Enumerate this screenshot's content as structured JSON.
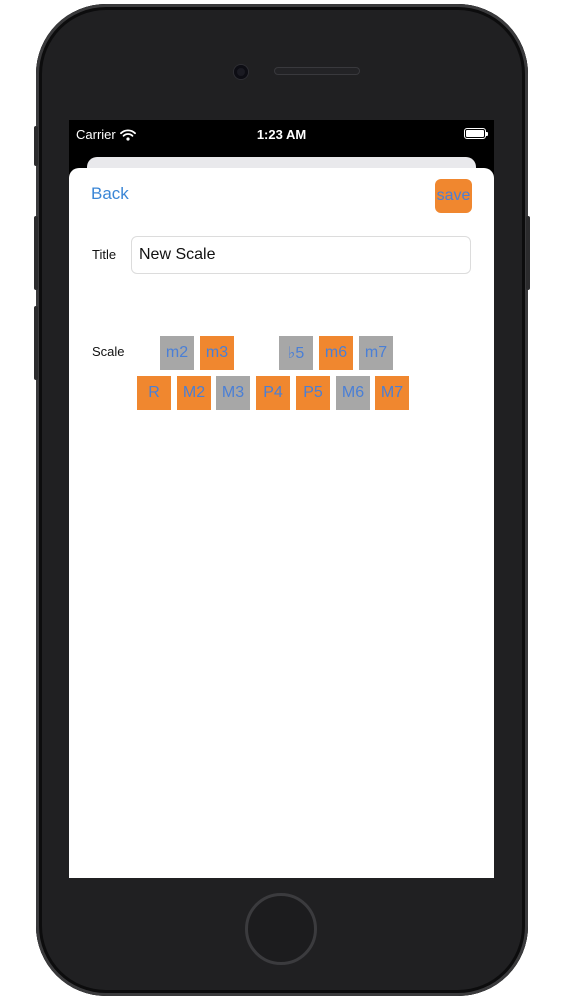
{
  "status_bar": {
    "carrier": "Carrier",
    "time": "1:23 AM"
  },
  "nav": {
    "back_label": "Back",
    "save_label": "save"
  },
  "form": {
    "title_label": "Title",
    "title_value": "New Scale",
    "scale_label": "Scale"
  },
  "scale": {
    "top_row": [
      {
        "label": "m2",
        "selected": false
      },
      {
        "label": "m3",
        "selected": true
      },
      {
        "label": "♭5",
        "selected": false
      },
      {
        "label": "m6",
        "selected": true
      },
      {
        "label": "m7",
        "selected": false
      }
    ],
    "bottom_row": [
      {
        "label": "R",
        "selected": true
      },
      {
        "label": "M2",
        "selected": true
      },
      {
        "label": "M3",
        "selected": false
      },
      {
        "label": "P4",
        "selected": true
      },
      {
        "label": "P5",
        "selected": true
      },
      {
        "label": "M6",
        "selected": false
      },
      {
        "label": "M7",
        "selected": true
      }
    ]
  },
  "colors": {
    "selected": "#f0872f",
    "unselected": "#a7a7a7",
    "link": "#3a86d6"
  }
}
